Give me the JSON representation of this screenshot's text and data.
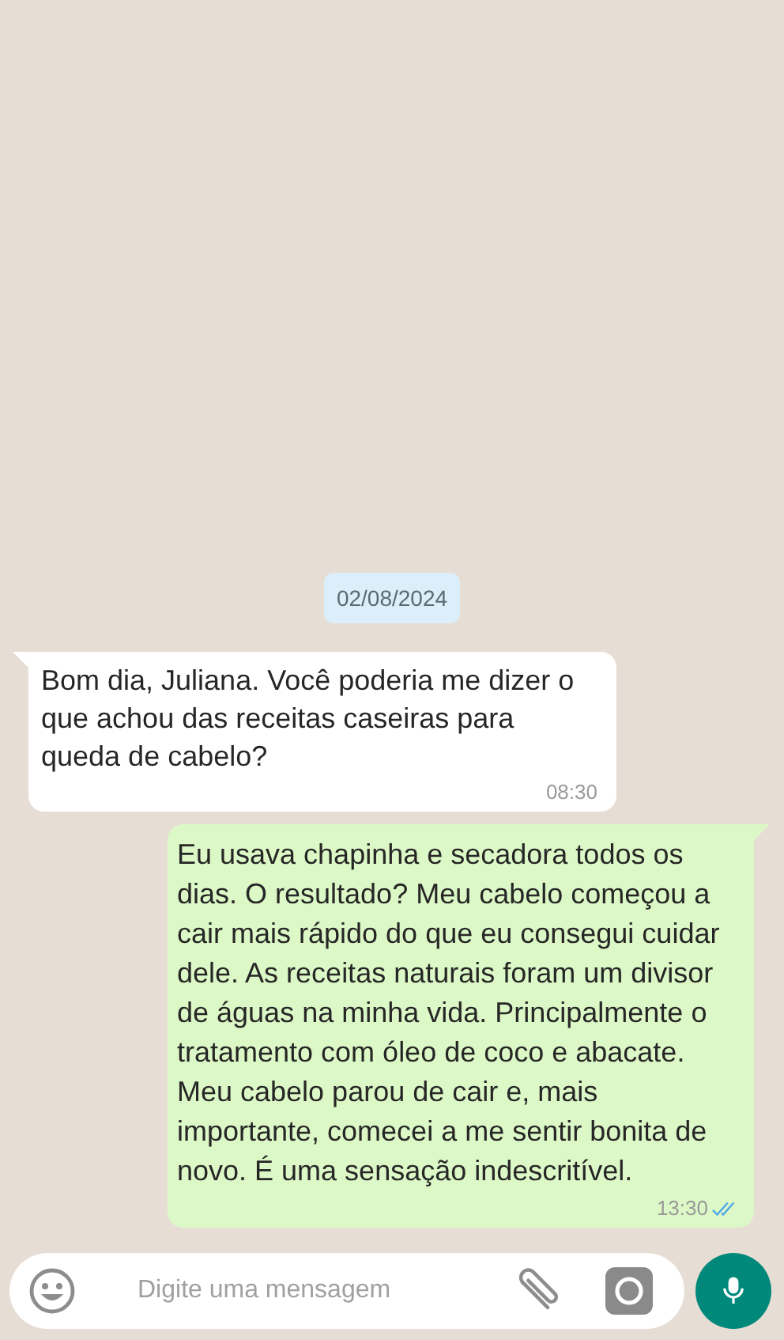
{
  "date_chip": "02/08/2024",
  "messages": [
    {
      "kind": "in",
      "text": "Bom dia, Juliana. Você poderia me dizer o que achou das receitas caseiras para queda de cabelo?",
      "time": "08:30"
    },
    {
      "kind": "out",
      "text": "Eu usava chapinha e secadora todos os dias. O resultado? Meu cabelo começou a cair mais rápido do que eu consegui cuidar dele. As receitas naturais foram um divisor de águas na minha vida. Principalmente o tratamento com óleo de coco e abacate. Meu cabelo parou de cair e, mais importante, comecei a me sentir bonita de novo. É uma sensação indescritível.",
      "time": "13:30",
      "read": true
    }
  ],
  "composer": {
    "placeholder": "Digite uma mensagem"
  }
}
